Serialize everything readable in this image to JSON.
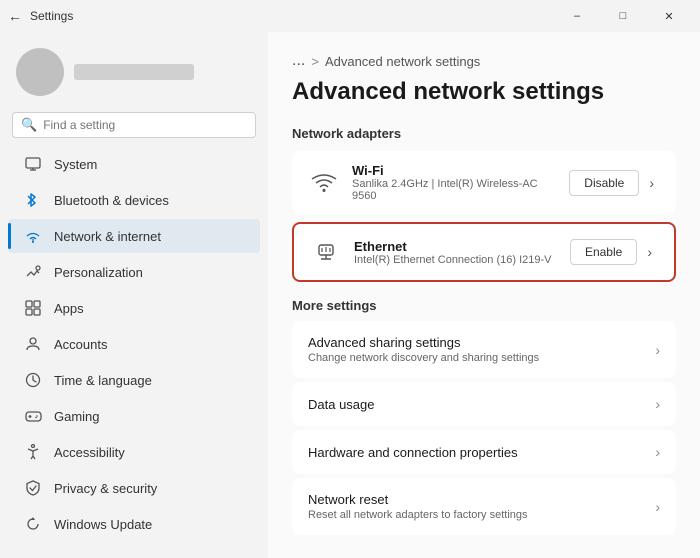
{
  "titleBar": {
    "title": "Settings",
    "minimize": "–",
    "maximize": "□",
    "close": "✕"
  },
  "sidebar": {
    "searchPlaceholder": "Find a setting",
    "navItems": [
      {
        "id": "system",
        "label": "System",
        "icon": "💻"
      },
      {
        "id": "bluetooth",
        "label": "Bluetooth & devices",
        "icon": "🔵"
      },
      {
        "id": "network",
        "label": "Network & internet",
        "icon": "🌐",
        "active": true
      },
      {
        "id": "personalization",
        "label": "Personalization",
        "icon": "✏️"
      },
      {
        "id": "apps",
        "label": "Apps",
        "icon": "📱"
      },
      {
        "id": "accounts",
        "label": "Accounts",
        "icon": "👤"
      },
      {
        "id": "time",
        "label": "Time & language",
        "icon": "🕐"
      },
      {
        "id": "gaming",
        "label": "Gaming",
        "icon": "🎮"
      },
      {
        "id": "accessibility",
        "label": "Accessibility",
        "icon": "♿"
      },
      {
        "id": "privacy",
        "label": "Privacy & security",
        "icon": "🛡️"
      },
      {
        "id": "update",
        "label": "Windows Update",
        "icon": "🔄"
      }
    ]
  },
  "main": {
    "breadcrumb": "...",
    "breadcrumbSep": ">",
    "breadcrumbPage": "Advanced network settings",
    "pageTitle": "Advanced network settings",
    "networkAdaptersTitle": "Network adapters",
    "adapters": [
      {
        "id": "wifi",
        "icon": "wifi",
        "name": "Wi-Fi",
        "desc": "Sanlika 2.4GHz | Intel(R) Wireless-AC 9560",
        "btnLabel": "Disable",
        "highlighted": false
      },
      {
        "id": "ethernet",
        "icon": "ethernet",
        "name": "Ethernet",
        "desc": "Intel(R) Ethernet Connection (16) I219-V",
        "btnLabel": "Enable",
        "highlighted": true
      }
    ],
    "moreSettingsTitle": "More settings",
    "settingsItems": [
      {
        "id": "sharing",
        "title": "Advanced sharing settings",
        "desc": "Change network discovery and sharing settings"
      },
      {
        "id": "datausage",
        "title": "Data usage",
        "desc": ""
      },
      {
        "id": "hardware",
        "title": "Hardware and connection properties",
        "desc": ""
      },
      {
        "id": "reset",
        "title": "Network reset",
        "desc": "Reset all network adapters to factory settings"
      }
    ]
  }
}
